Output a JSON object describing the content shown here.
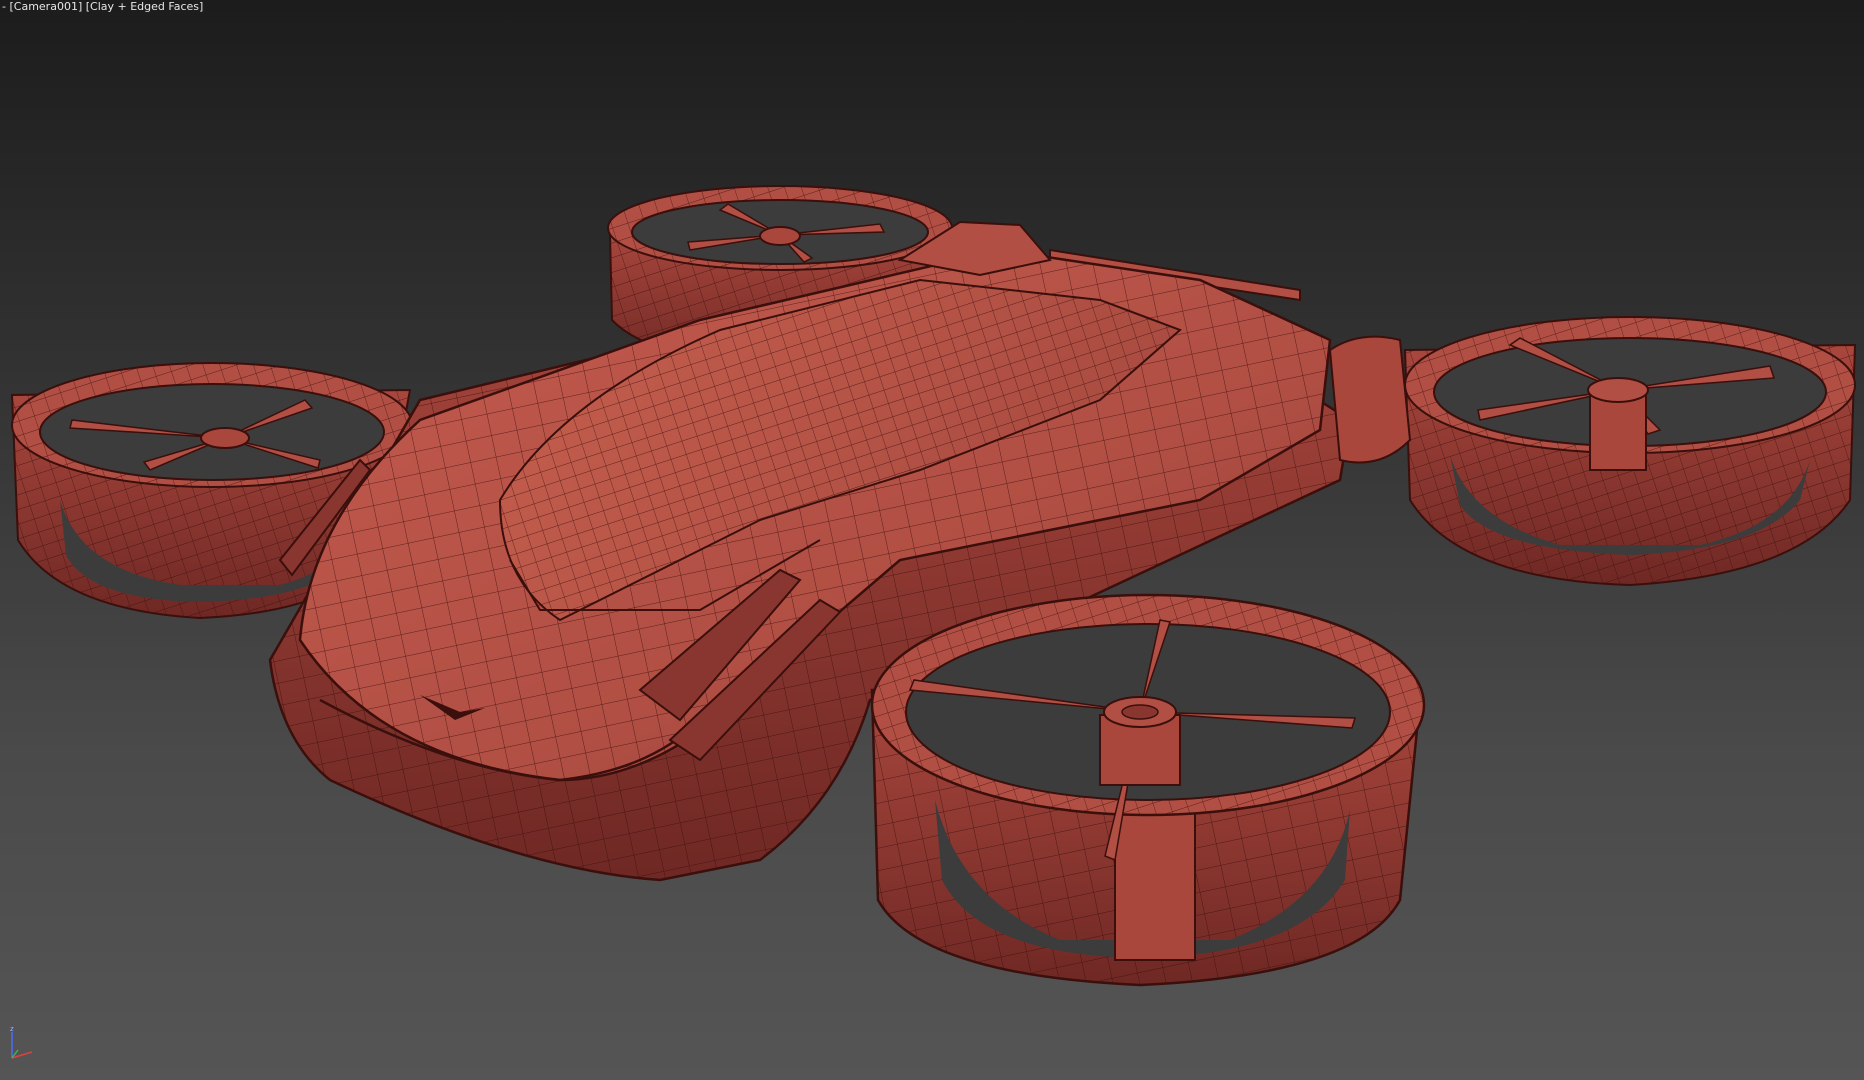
{
  "viewport": {
    "menu_label": "-",
    "camera_label": "[Camera001]",
    "shading_label": "[Clay + Edged Faces]"
  },
  "gizmo": {
    "z_label": "z"
  },
  "colors": {
    "background_top": "#1c1c1c",
    "background_bottom": "#555555",
    "clay": "#b14f44",
    "clay_dark": "#7e2f2a",
    "edge": "#3a0f0c"
  },
  "scene": {
    "object_name": "flying-car-drone-model",
    "view_mode": "Clay + Edged Faces"
  }
}
